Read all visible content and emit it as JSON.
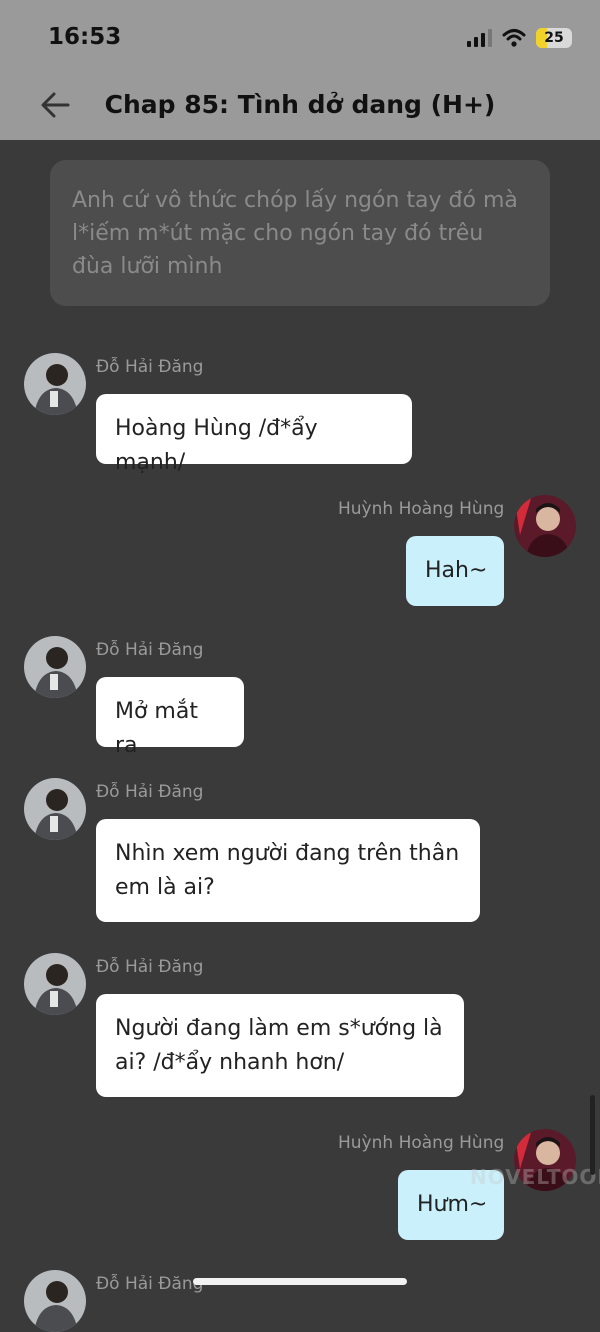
{
  "status": {
    "time": "16:53",
    "battery": "25"
  },
  "header": {
    "title": "Chap 85: Tình dở dang (H+)"
  },
  "narration": "Anh cứ vô thức chóp lấy ngón tay đó mà l*iếm m*út mặc cho ngón tay đó trêu đùa lưỡi mình",
  "messages": [
    {
      "sender": "Đỗ Hải Đăng",
      "text": "Hoàng Hùng /đ*ẩy mạnh/",
      "side": "left"
    },
    {
      "sender": "Huỳnh Hoàng Hùng",
      "text": "Hah~",
      "side": "right"
    },
    {
      "sender": "Đỗ Hải Đăng",
      "text": "Mở mắt ra",
      "side": "left"
    },
    {
      "sender": "Đỗ Hải Đăng",
      "text": "Nhìn xem người đang trên thân em là ai?",
      "side": "left"
    },
    {
      "sender": "Đỗ Hải Đăng",
      "text": "Người đang làm em s*ướng là ai? /đ*ẩy nhanh hơn/",
      "side": "left"
    },
    {
      "sender": "Huỳnh Hoàng Hùng",
      "text": "Hưm~",
      "side": "right"
    },
    {
      "sender": "Đỗ Hải Đăng",
      "text": "",
      "side": "left"
    }
  ],
  "watermark": "NOVELTOON",
  "icons": [
    "back-arrow-icon",
    "signal-icon",
    "wifi-icon",
    "battery-icon"
  ],
  "colors": {
    "bubble_left": "#ffffff",
    "bubble_right": "#c9f0fb",
    "background": "#3a3a3a",
    "header": "#9a9a9a"
  }
}
